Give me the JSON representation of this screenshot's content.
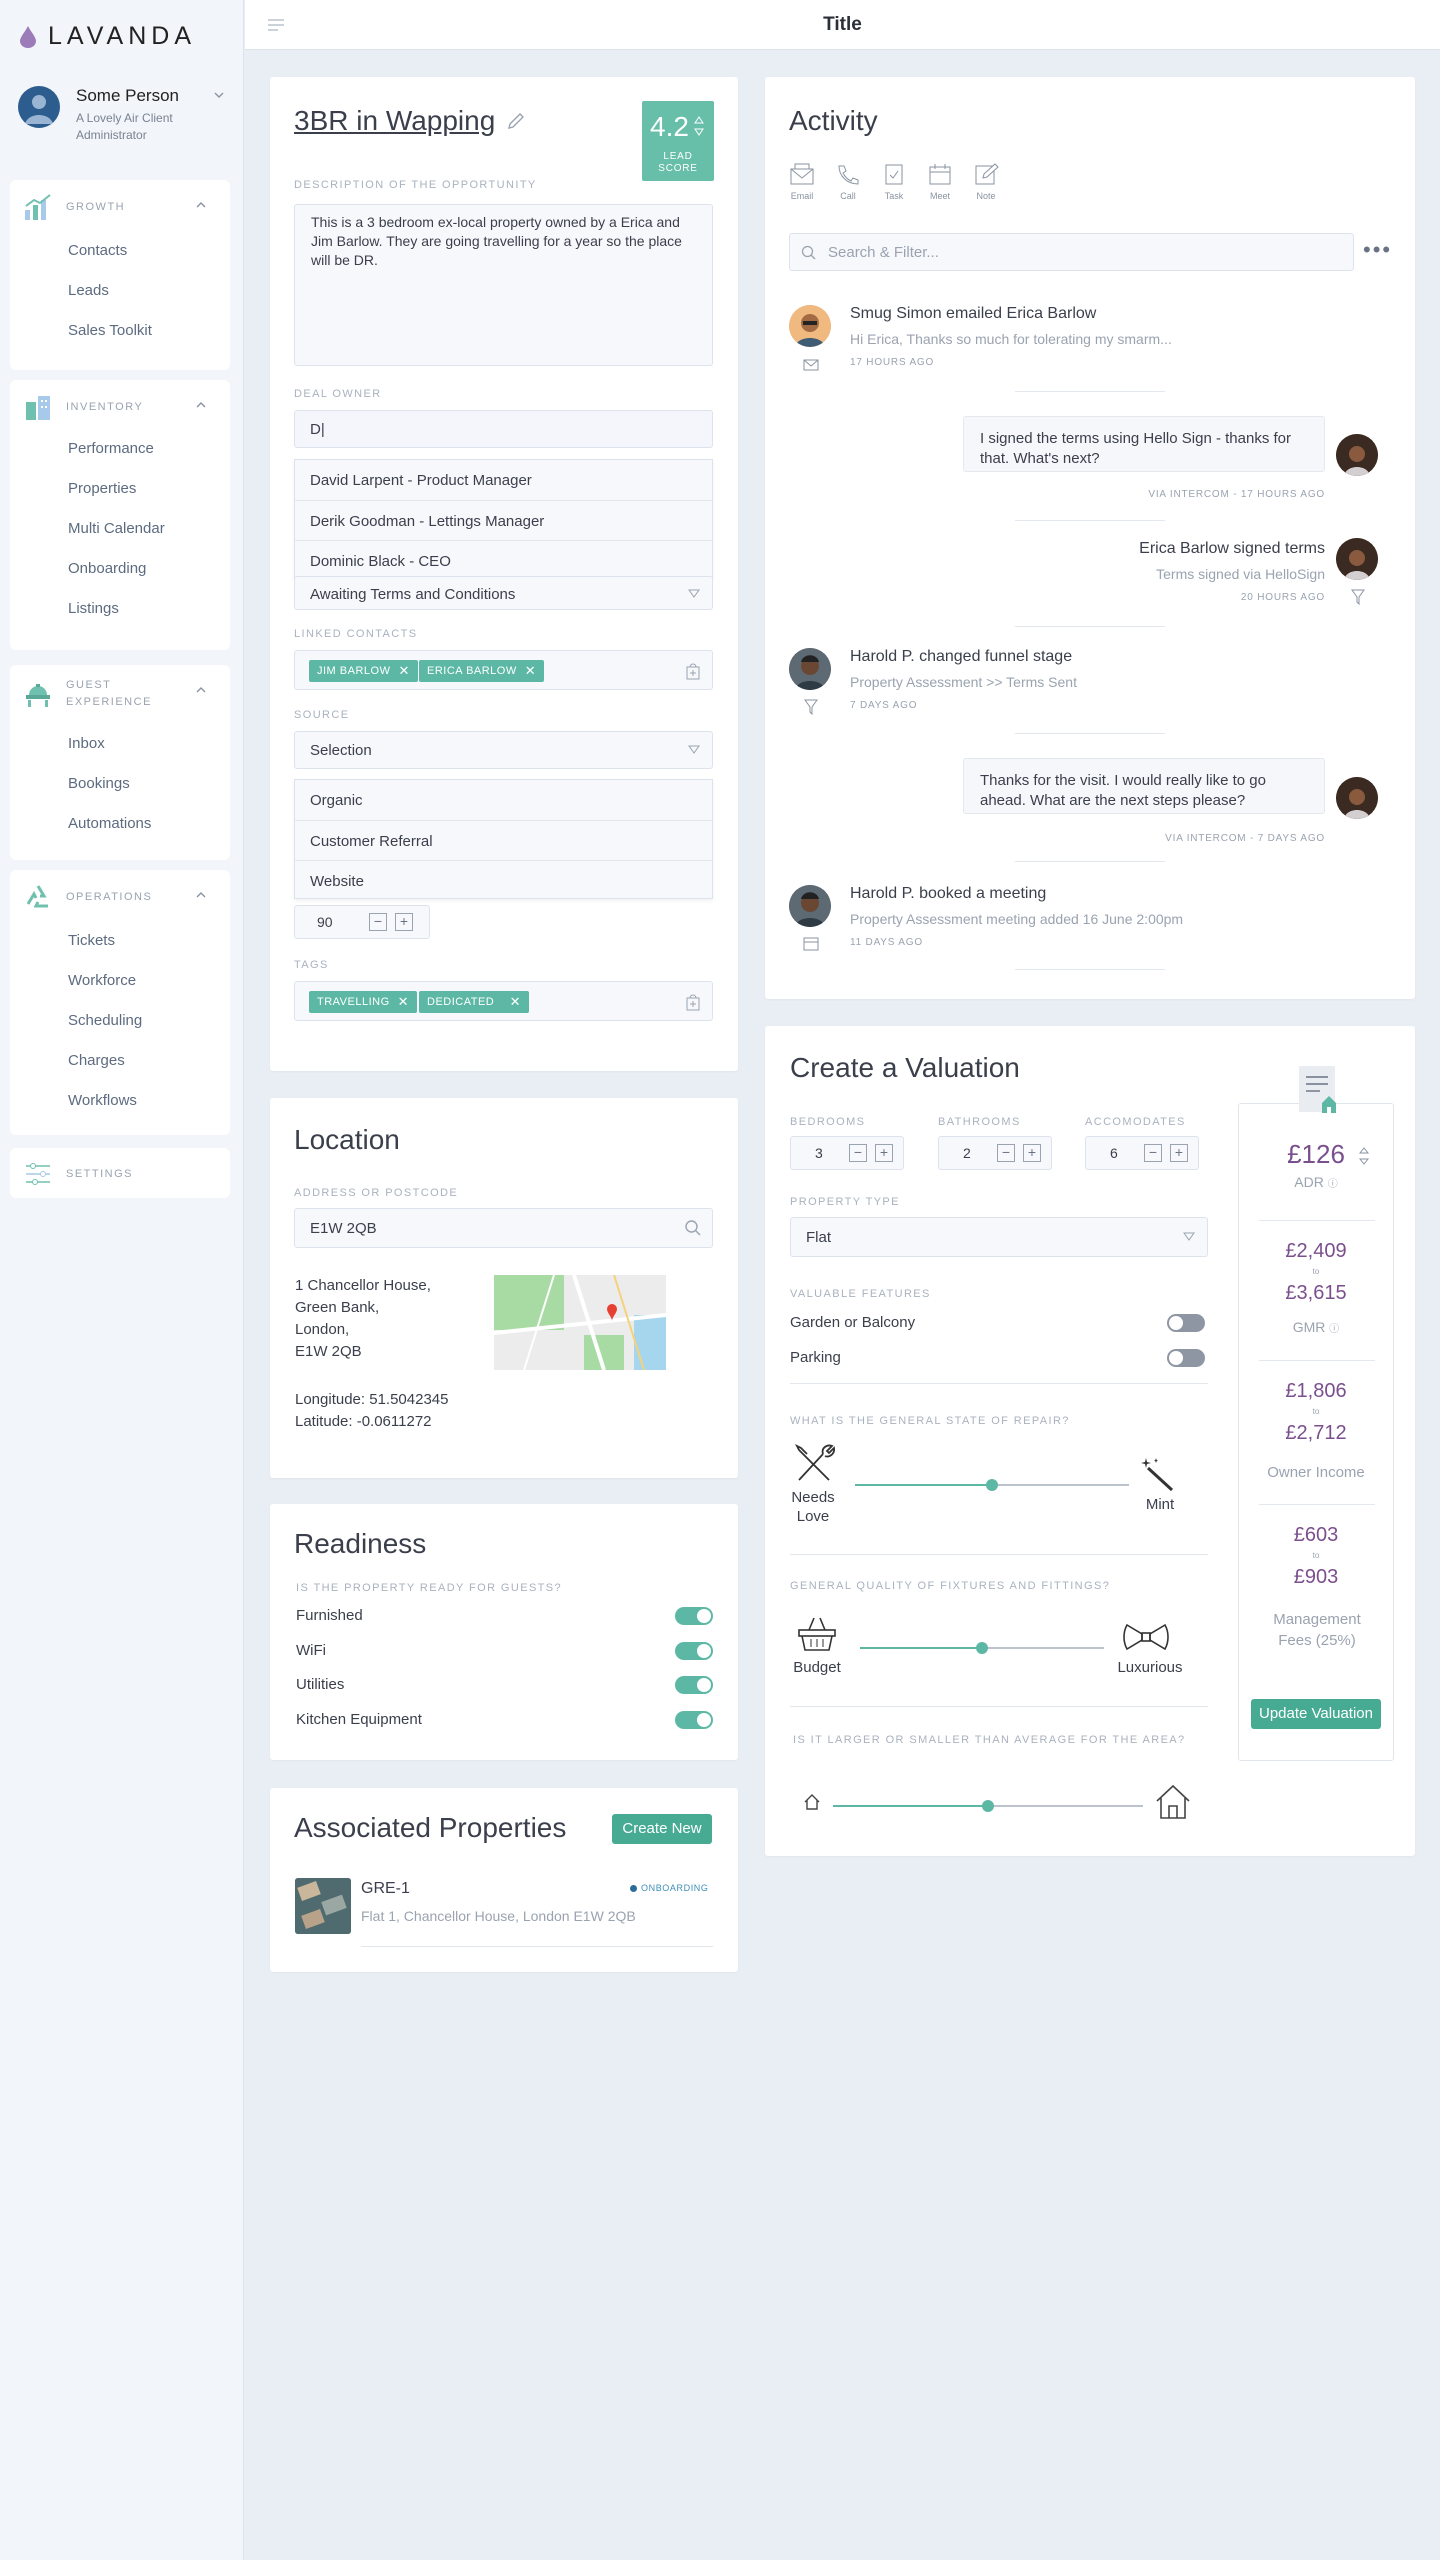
{
  "app": {
    "logo": "LAVANDA",
    "page_title": "Title"
  },
  "user": {
    "name": "Some Person",
    "org": "A Lovely Air Client",
    "role": "Administrator"
  },
  "sidebar": {
    "sections": [
      {
        "title": "GROWTH",
        "items": [
          "Contacts",
          "Leads",
          "Sales Toolkit"
        ]
      },
      {
        "title": "INVENTORY",
        "items": [
          "Performance",
          "Properties",
          "Multi Calendar",
          "Onboarding",
          "Listings"
        ]
      },
      {
        "title": "GUEST EXPERIENCE",
        "items": [
          "Inbox",
          "Bookings",
          "Automations"
        ]
      },
      {
        "title": "OPERATIONS",
        "items": [
          "Tickets",
          "Workforce",
          "Scheduling",
          "Charges",
          "Workflows"
        ]
      }
    ],
    "settings": "SETTINGS"
  },
  "deal": {
    "title": "3BR in Wapping",
    "lead_score": "4.2",
    "lead_score_label_1": "LEAD",
    "lead_score_label_2": "SCORE",
    "description_label": "DESCRIPTION OF THE OPPORTUNITY",
    "description": "This is a 3 bedroom ex-local property owned by a Erica and Jim Barlow. They are going travelling for a year so the place will be DR.",
    "owner_label": "DEAL OWNER",
    "owner_value": "D|",
    "owner_options": [
      "David Larpent - Product Manager",
      "Derik Goodman - Lettings Manager",
      "Dominic Black - CEO"
    ],
    "stage_value": "Awaiting Terms and Conditions",
    "linked_label": "LINKED CONTACTS",
    "linked_contacts": [
      "JIM BARLOW",
      "ERICA BARLOW"
    ],
    "source_label": "SOURCE",
    "source_value": "Selection",
    "source_options": [
      "Organic",
      "Customer Referral",
      "Website"
    ],
    "score_value": "90",
    "tags_label": "TAGS",
    "tags": [
      "TRAVELLING",
      "DEDICATED"
    ]
  },
  "location": {
    "title": "Location",
    "address_label": "ADDRESS OR POSTCODE",
    "postcode": "E1W 2QB",
    "address_lines": [
      "1 Chancellor House,",
      "Green Bank,",
      "London,",
      "E1W 2QB"
    ],
    "longitude": "Longitude: 51.5042345",
    "latitude": "Latitude: -0.0611272"
  },
  "readiness": {
    "title": "Readiness",
    "question": "IS THE PROPERTY READY FOR GUESTS?",
    "items": [
      {
        "label": "Furnished",
        "on": true
      },
      {
        "label": "WiFi",
        "on": true
      },
      {
        "label": "Utilities",
        "on": true
      },
      {
        "label": "Kitchen Equipment",
        "on": true
      }
    ]
  },
  "associated": {
    "title": "Associated Properties",
    "create_label": "Create New",
    "property_code": "GRE-1",
    "property_status": "ONBOARDING",
    "property_address": "Flat 1, Chancellor House, London E1W 2QB"
  },
  "activity": {
    "title": "Activity",
    "actions": [
      "Email",
      "Call",
      "Task",
      "Meet",
      "Note"
    ],
    "search_placeholder": "Search & Filter...",
    "items": [
      {
        "title": "Smug Simon emailed Erica Barlow",
        "sub": "Hi Erica, Thanks so much for tolerating my smarm...",
        "time": "17 HOURS AGO"
      },
      {
        "message": "I signed the terms using Hello Sign - thanks for that. What's next?",
        "time": "VIA INTERCOM - 17 HOURS AGO"
      },
      {
        "title": "Erica Barlow signed terms",
        "sub": "Terms signed via HelloSign",
        "time": "20 HOURS AGO"
      },
      {
        "title": "Harold P. changed funnel stage",
        "sub": "Property Assessment >> Terms Sent",
        "time": "7 DAYS AGO"
      },
      {
        "message": "Thanks for the visit. I would really like to go ahead. What are the next steps please?",
        "time": "VIA INTERCOM - 7 DAYS AGO"
      },
      {
        "title": "Harold P. booked a meeting",
        "sub": "Property Assessment meeting added 16 June 2:00pm",
        "time": "11 DAYS AGO"
      }
    ]
  },
  "valuation": {
    "title": "Create a Valuation",
    "bedrooms_label": "BEDROOMS",
    "bedrooms": "3",
    "bathrooms_label": "BATHROOMS",
    "bathrooms": "2",
    "accomodates_label": "ACCOMODATES",
    "accomodates": "6",
    "property_type_label": "PROPERTY TYPE",
    "property_type": "Flat",
    "features_label": "VALUABLE FEATURES",
    "features": [
      {
        "label": "Garden or Balcony",
        "on": false
      },
      {
        "label": "Parking",
        "on": false
      }
    ],
    "repair_label": "WHAT IS THE GENERAL STATE OF REPAIR?",
    "repair_low": "Needs Love",
    "repair_high": "Mint",
    "repair_level": 0.5,
    "quality_label": "GENERAL QUALITY OF FIXTURES AND FITTINGS?",
    "quality_low": "Budget",
    "quality_high": "Luxurious",
    "quality_level": 0.5,
    "size_label": "IS IT LARGER OR SMALLER THAN AVERAGE FOR THE AREA?",
    "size_level": 0.5,
    "adr": "£126",
    "adr_label": "ADR",
    "gmr_low": "£2,409",
    "gmr_high": "£3,615",
    "gmr_label": "GMR",
    "income_low": "£1,806",
    "income_high": "£2,712",
    "income_label": "Owner Income",
    "fees_low": "£603",
    "fees_high": "£903",
    "fees_label": "Management Fees (25%)",
    "to": "to",
    "update_label": "Update Valuation"
  },
  "colors": {
    "accent": "#5cb8a5",
    "brand": "#7b4f8e",
    "text": "#3a3f4b"
  }
}
